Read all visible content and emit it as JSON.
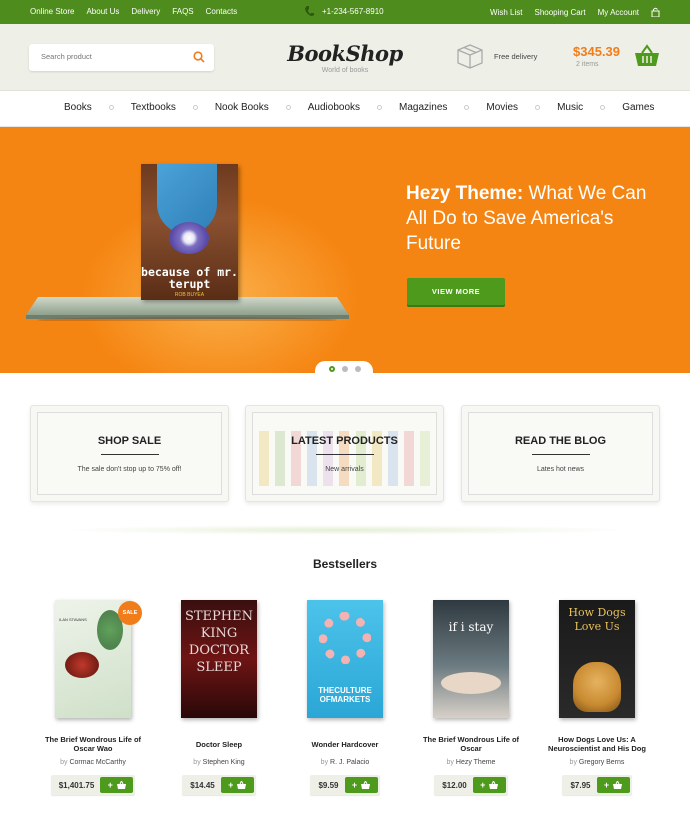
{
  "topbar": {
    "left_links": [
      "Online Store",
      "About Us",
      "Delivery",
      "FAQS",
      "Contacts"
    ],
    "phone": "+1-234-567-8910",
    "right_links": [
      "Wish List",
      "Shooping Cart",
      "My Account"
    ]
  },
  "header": {
    "search_placeholder": "Search product",
    "logo_title": "BookShop",
    "logo_subtitle": "World of books",
    "delivery_label": "Free delivery",
    "cart_total": "$345.39",
    "cart_items": "2 items"
  },
  "nav": {
    "items": [
      "Books",
      "Textbooks",
      "Nook Books",
      "Audiobooks",
      "Magazines",
      "Movies",
      "Music",
      "Games"
    ]
  },
  "hero": {
    "book_title": "because of mr. terupt",
    "book_author": "ROB BUYEA",
    "headline_bold": "Hezy Theme:",
    "headline_rest": " What We Can All Do to Save America's Future",
    "button_label": "VIEW MORE"
  },
  "promos": [
    {
      "title": "SHOP SALE",
      "subtitle": "The sale don't stop up to 75% off!"
    },
    {
      "title": "LATEST PRODUCTS",
      "subtitle": "New arrivals"
    },
    {
      "title": "READ THE BLOG",
      "subtitle": "Lates hot news"
    }
  ],
  "bestsellers": {
    "title": "Bestsellers",
    "sale_badge": "SALE",
    "by_label": "by",
    "products": [
      {
        "title": "The Brief Wondrous Life of Oscar Wao",
        "author": "Cormac McCarthy",
        "price": "$1,401.75",
        "cover_text": "ILAN STAVANS"
      },
      {
        "title": "Doctor Sleep",
        "author": "Stephen King",
        "price": "$14.45",
        "cover_text": "STEPHEN KING DOCTOR SLEEP"
      },
      {
        "title": "Wonder Hardcover",
        "author": "R. J. Palacio",
        "price": "$9.59",
        "cover_text": "THECULTURE OFMARKETS"
      },
      {
        "title": "The Brief Wondrous Life of Oscar",
        "author": "Hezy Theme",
        "price": "$12.00",
        "cover_text": "if i stay"
      },
      {
        "title": "How Dogs Love Us: A Neuroscientist and His Dog",
        "author": "Gregory Berns",
        "price": "$7.95",
        "cover_text": "How Dogs Love Us"
      }
    ]
  },
  "colors": {
    "brand_green": "#4e8c1d",
    "accent_orange": "#f58512"
  }
}
